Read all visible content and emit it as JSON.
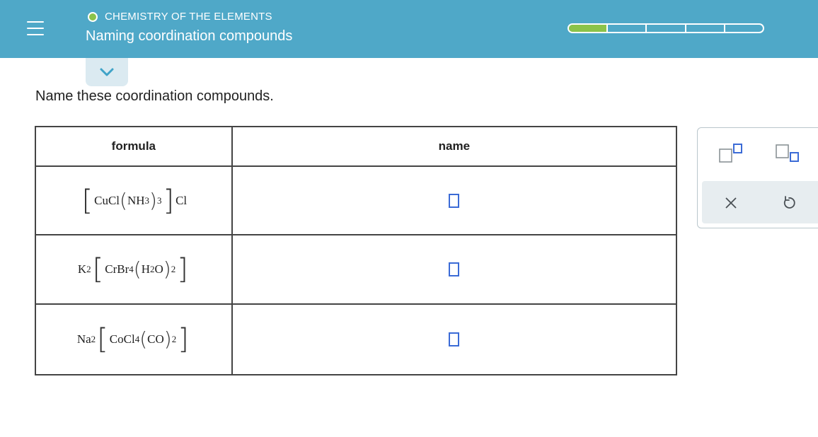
{
  "header": {
    "breadcrumb": "CHEMISTRY OF THE ELEMENTS",
    "title": "Naming coordination compounds",
    "progress": {
      "filled_segments": 1,
      "total_segments": 5
    },
    "colors": {
      "bar": "#4fa8c8",
      "progress_fill": "#8bc34a"
    }
  },
  "icons": {
    "menu": "hamburger-menu-icon",
    "collapse": "chevron-down-icon",
    "superscript": "superscript-box-icon",
    "subscript": "subscript-box-icon",
    "clear": "close-icon",
    "undo": "undo-icon"
  },
  "question": {
    "prompt": "Name these coordination compounds."
  },
  "table": {
    "headers": [
      "formula",
      "name"
    ],
    "rows": [
      {
        "prefix": "",
        "metal": "Cu",
        "ligand1": "Cl",
        "ligand1_sub": "",
        "ligand2": "NH",
        "ligand2_sub": "3",
        "ligand2_count": "3",
        "counter_ion": "Cl",
        "name_value": ""
      },
      {
        "prefix": "K",
        "prefix_sub": "2",
        "metal": "Cr",
        "ligand1": "Br",
        "ligand1_sub": "4",
        "ligand2": "H",
        "ligand2_sub": "2",
        "ligand2_tail": "O",
        "ligand2_count": "2",
        "name_value": ""
      },
      {
        "prefix": "Na",
        "prefix_sub": "2",
        "metal": "Co",
        "ligand1": "Cl",
        "ligand1_sub": "4",
        "ligand2": "CO",
        "ligand2_count": "2",
        "name_value": ""
      }
    ]
  },
  "colors": {
    "answer_box": "#3b6bd6",
    "palette_bg": "#e7edf0"
  }
}
